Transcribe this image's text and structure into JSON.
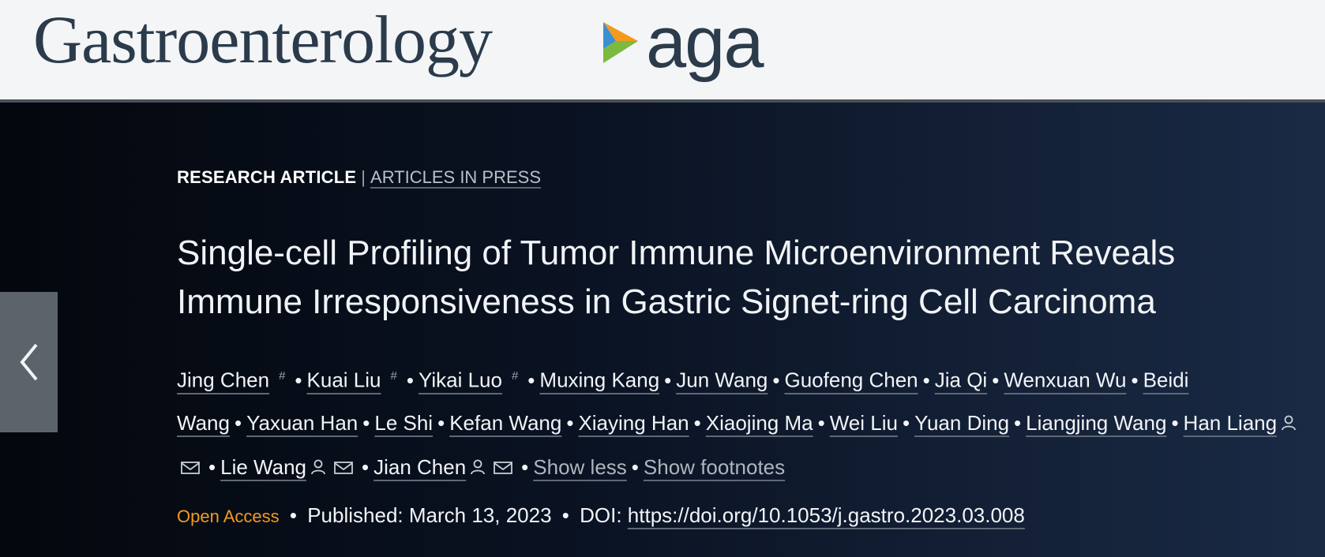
{
  "header": {
    "journal_title": "Gastroenterology",
    "logo_text": "aga",
    "logo_colors": [
      "#f39a1e",
      "#3b8fd1",
      "#7bb93f"
    ]
  },
  "breadcrumb": {
    "article_type": "RESEARCH ARTICLE",
    "separator": "|",
    "issue": "ARTICLES IN PRESS"
  },
  "article": {
    "title_line1": "Single-cell Profiling of Tumor Immune Microenvironment Reveals",
    "title_line2": "Immune Irresponsiveness in Gastric Signet-ring Cell Carcinoma"
  },
  "authors": [
    {
      "name": "Jing Chen",
      "footnote": "#"
    },
    {
      "name": "Kuai Liu",
      "footnote": "#"
    },
    {
      "name": "Yikai Luo",
      "footnote": "#"
    },
    {
      "name": "Muxing Kang"
    },
    {
      "name": "Jun Wang"
    },
    {
      "name": "Guofeng Chen"
    },
    {
      "name": "Jia Qi"
    },
    {
      "name": "Wenxuan Wu"
    },
    {
      "name": "Beidi Wang"
    },
    {
      "name": "Yaxuan Han"
    },
    {
      "name": "Le Shi"
    },
    {
      "name": "Kefan Wang"
    },
    {
      "name": "Xiaying Han"
    },
    {
      "name": "Xiaojing Ma"
    },
    {
      "name": "Wei Liu"
    },
    {
      "name": "Yuan Ding"
    },
    {
      "name": "Liangjing Wang"
    },
    {
      "name": "Han Liang",
      "corresponding": true
    },
    {
      "name": "Lie Wang",
      "corresponding": true
    },
    {
      "name": "Jian Chen",
      "corresponding": true
    }
  ],
  "author_actions": {
    "show_less": "Show less",
    "show_footnotes": "Show footnotes"
  },
  "meta": {
    "open_access": "Open Access",
    "published": "Published: March 13, 2023",
    "doi_label": "DOI:",
    "doi_url": "https://doi.org/10.1053/j.gastro.2023.03.008"
  },
  "icons": {
    "prev": "chevron-left-icon",
    "person": "person-icon",
    "email": "envelope-icon"
  }
}
